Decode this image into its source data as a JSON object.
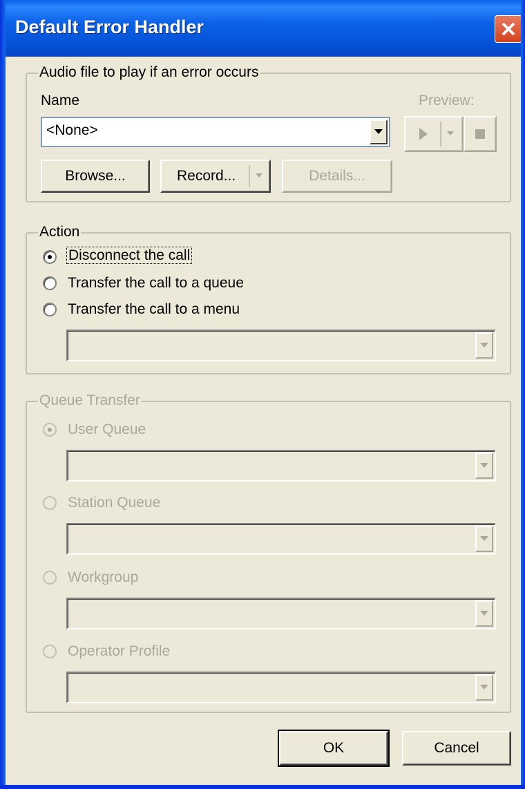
{
  "window": {
    "title": "Default Error Handler"
  },
  "audio_group": {
    "title": "Audio file to play if an error occurs",
    "name_label": "Name",
    "name_value": "<None>",
    "preview_label": "Preview:",
    "browse_label": "Browse...",
    "record_label": "Record...",
    "details_label": "Details..."
  },
  "action_group": {
    "title": "Action",
    "options": [
      {
        "label": "Disconnect the call",
        "selected": true
      },
      {
        "label": "Transfer the call to a queue",
        "selected": false
      },
      {
        "label": "Transfer the call to a menu",
        "selected": false
      }
    ],
    "menu_value": ""
  },
  "queue_group": {
    "title": "Queue Transfer",
    "options": [
      {
        "label": "User Queue",
        "selected": true
      },
      {
        "label": "Station Queue",
        "selected": false
      },
      {
        "label": "Workgroup",
        "selected": false
      },
      {
        "label": "Operator Profile",
        "selected": false
      }
    ]
  },
  "buttons": {
    "ok": "OK",
    "cancel": "Cancel"
  }
}
